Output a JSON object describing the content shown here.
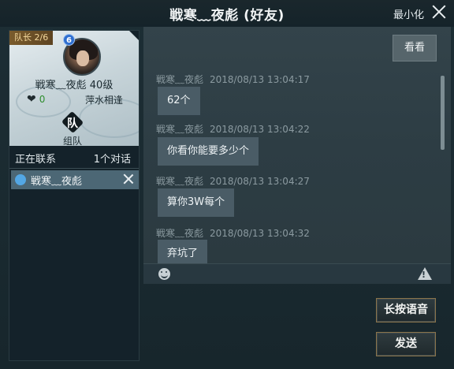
{
  "window": {
    "title": "戦寒﹏夜彪 (好友)",
    "minimize_label": "最小化"
  },
  "profile": {
    "leader_badge": "队长 2/6",
    "avatar_badge": "6",
    "name_level": "戦寒﹏夜彪  40级",
    "intimacy": "0",
    "relation": "萍水相逢",
    "team_label": "组队"
  },
  "contacts": {
    "header_left": "正在联系",
    "header_right": "1个对话",
    "items": [
      {
        "name": "戦寒﹏夜彪"
      }
    ]
  },
  "chat": {
    "my_message": "看看",
    "messages": [
      {
        "sender": "戦寒﹏夜彪",
        "time": "2018/08/13  13:04:17",
        "text": "62个"
      },
      {
        "sender": "戦寒﹏夜彪",
        "time": "2018/08/13  13:04:22",
        "text": "你看你能要多少个"
      },
      {
        "sender": "戦寒﹏夜彪",
        "time": "2018/08/13  13:04:27",
        "text": "算你3W每个"
      },
      {
        "sender": "戦寒﹏夜彪",
        "time": "2018/08/13  13:04:32",
        "text": "弃坑了"
      }
    ]
  },
  "buttons": {
    "voice_label": "长按语音",
    "send_label": "发送"
  },
  "icons": {
    "close": "close-icon",
    "emoji": "emoji-icon",
    "warning": "warning-icon",
    "heart": "heart-icon",
    "team": "team-icon"
  }
}
